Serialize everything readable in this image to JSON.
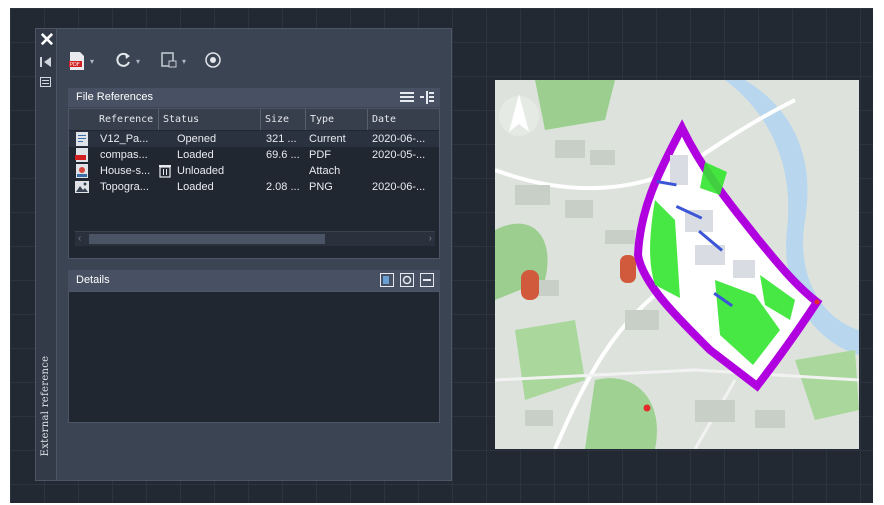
{
  "palette": {
    "title": "External reference",
    "toolbar": [
      "attach-pdf",
      "refresh",
      "change-path",
      "help"
    ]
  },
  "file_references": {
    "heading": "File References",
    "columns": [
      "Reference",
      "Status",
      "Size",
      "Type",
      "Date"
    ],
    "rows": [
      {
        "reference": "V12_Pa...",
        "status": "Opened",
        "size": "321 ...",
        "type": "Current",
        "date": "2020-06-...",
        "icon": "dwg-icon",
        "selected": true
      },
      {
        "reference": "compas...",
        "status": "Loaded",
        "size": "69.6 ...",
        "type": "PDF",
        "date": "2020-05-...",
        "icon": "pdf-icon",
        "selected": false
      },
      {
        "reference": "House-s...",
        "status": "Unloaded",
        "size": "",
        "type": "Attach",
        "date": "",
        "icon": "dwg-icon",
        "selected": false
      },
      {
        "reference": "Topogra...",
        "status": "Loaded",
        "size": "2.08 ...",
        "type": "PNG",
        "date": "2020-06-...",
        "icon": "image-icon",
        "selected": false
      }
    ]
  },
  "details": {
    "heading": "Details"
  },
  "colors": {
    "canvas": "#222933",
    "palette": "#3b4453",
    "boundary": "#b000e0",
    "vegetation": "#35e630",
    "water": "#b8d6ee",
    "parkland": "#9ccf8f"
  }
}
